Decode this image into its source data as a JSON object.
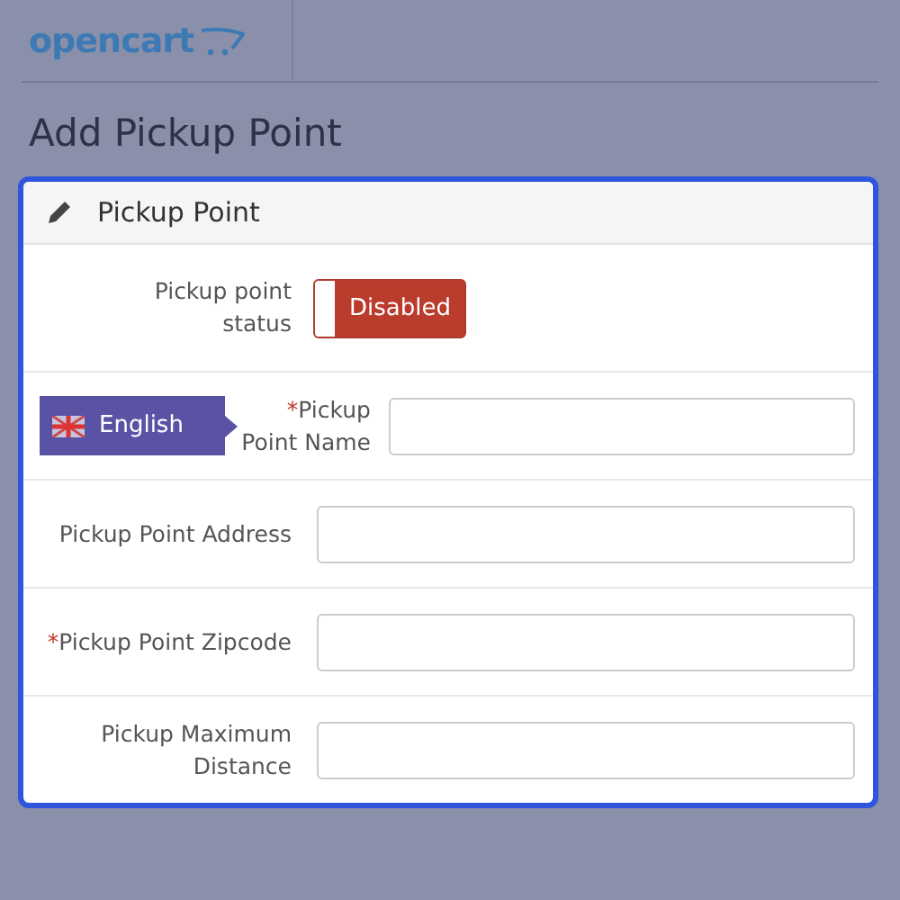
{
  "header": {
    "logo": "opencart"
  },
  "page_title": "Add Pickup Point",
  "panel": {
    "title": "Pickup Point",
    "status": {
      "label": "Pickup point status",
      "on": false,
      "toggle_text": "Disabled"
    },
    "language_badge": "English",
    "required_mark": "*",
    "fields": [
      {
        "label": "Pickup Point Name",
        "required": true,
        "kind": "language"
      },
      {
        "label": "Pickup Point Address",
        "required": false,
        "kind": "plain"
      },
      {
        "label": "Pickup Point Zipcode",
        "required": true,
        "kind": "plain"
      },
      {
        "label": "Pickup Maximum Distance",
        "required": false,
        "kind": "plain"
      }
    ]
  }
}
